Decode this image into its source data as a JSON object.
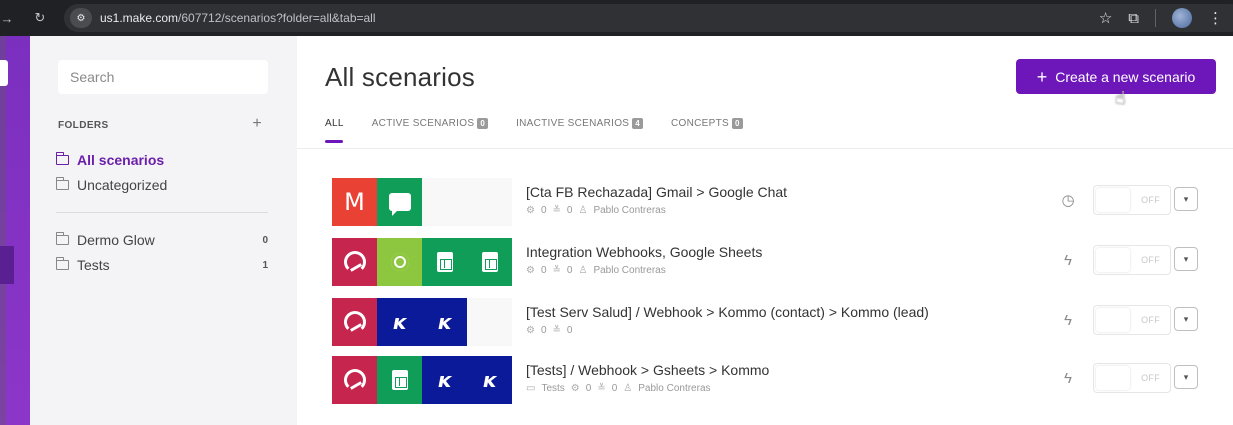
{
  "browser": {
    "url_host": "us1.make.com",
    "url_path": "/607712/scenarios?folder=all&tab=all"
  },
  "sidebar": {
    "search_placeholder": "Search",
    "folders_title": "FOLDERS",
    "add_label": "+",
    "items": [
      {
        "label": "All scenarios",
        "count": ""
      },
      {
        "label": "Uncategorized",
        "count": ""
      },
      {
        "label": "Dermo Glow",
        "count": "0"
      },
      {
        "label": "Tests",
        "count": "1"
      }
    ]
  },
  "main": {
    "title": "All scenarios",
    "create_button": "Create a new scenario",
    "tabs": [
      {
        "label": "ALL",
        "badge": ""
      },
      {
        "label": "ACTIVE SCENARIOS",
        "badge": "0"
      },
      {
        "label": "INACTIVE SCENARIOS",
        "badge": "4"
      },
      {
        "label": "CONCEPTS",
        "badge": "0"
      }
    ],
    "scenarios": [
      {
        "name": "[Cta FB Rechazada] Gmail > Google Chat",
        "ops": "0",
        "transfer": "0",
        "owner": "Pablo Contreras",
        "folder": "",
        "status": "OFF",
        "modules": [
          "gmail",
          "google-chat"
        ]
      },
      {
        "name": "Integration Webhooks, Google Sheets",
        "ops": "0",
        "transfer": "0",
        "owner": "Pablo Contreras",
        "folder": "",
        "status": "OFF",
        "modules": [
          "webhooks",
          "tools",
          "google-sheets",
          "google-sheets"
        ]
      },
      {
        "name": "[Test Serv Salud] / Webhook > Kommo (contact) > Kommo (lead)",
        "ops": "0",
        "transfer": "0",
        "owner": "",
        "folder": "",
        "status": "OFF",
        "modules": [
          "webhooks",
          "kommo",
          "kommo"
        ]
      },
      {
        "name": "[Tests] / Webhook > Gsheets > Kommo",
        "ops": "0",
        "transfer": "0",
        "owner": "Pablo Contreras",
        "folder": "Tests",
        "status": "OFF",
        "modules": [
          "webhooks",
          "google-sheets",
          "kommo",
          "kommo"
        ]
      }
    ]
  },
  "colors": {
    "accent": "#6d16b9",
    "rail": "#8c36c9",
    "gmail": "#e94235",
    "google_green": "#0f9d58",
    "webhooks": "#c6254d",
    "tools": "#8dc63f",
    "kommo": "#0a1a99"
  }
}
